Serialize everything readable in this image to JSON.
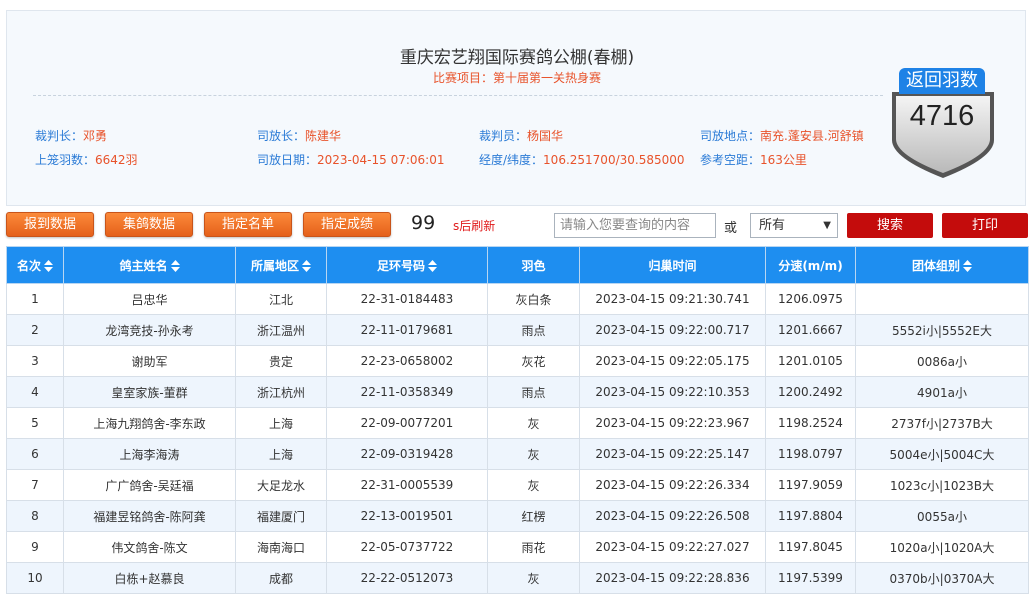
{
  "header": {
    "title": "重庆宏艺翔国际赛鸽公棚(春棚)",
    "subtitle": "比赛项目：第十届第一关热身赛",
    "info": [
      {
        "key": "裁判长：",
        "value": "邓勇"
      },
      {
        "key": "司放长：",
        "value": "陈建华"
      },
      {
        "key": "裁判员：",
        "value": "杨国华"
      },
      {
        "key": "司放地点：",
        "value": "南充.蓬安县.河舒镇"
      },
      {
        "key": "上笼羽数：",
        "value": "6642羽"
      },
      {
        "key": "司放日期：",
        "value": "2023-04-15 07:06:01"
      },
      {
        "key": "经度/纬度：",
        "value": "106.251700/30.585000"
      },
      {
        "key": "参考空距：",
        "value": "163公里"
      }
    ]
  },
  "returns": {
    "label": "返回羽数",
    "count": "4716",
    "color": "#1e82e6"
  },
  "toolbar": {
    "buttons": [
      "报到数据",
      "集鸽数据",
      "指定名单",
      "指定成绩"
    ],
    "countdown": "99",
    "countdown_suffix": "s后刷新",
    "search_placeholder": "请输入您要查询的内容",
    "or_label": "或",
    "select_value": "所有",
    "search_label": "搜索",
    "print_label": "打印"
  },
  "table": {
    "columns": [
      "名次",
      "鸽主姓名",
      "所属地区",
      "足环号码",
      "羽色",
      "归巢时间",
      "分速(m/m)",
      "团体组别"
    ],
    "sortable": [
      true,
      true,
      true,
      true,
      false,
      false,
      false,
      true
    ],
    "rows": [
      [
        "1",
        "吕忠华",
        "江北",
        "22-31-0184483",
        "灰白条",
        "2023-04-15 09:21:30.741",
        "1206.0975",
        ""
      ],
      [
        "2",
        "龙湾竞技-孙永考",
        "浙江温州",
        "22-11-0179681",
        "雨点",
        "2023-04-15 09:22:00.717",
        "1201.6667",
        "5552i小|5552E大"
      ],
      [
        "3",
        "谢助军",
        "贵定",
        "22-23-0658002",
        "灰花",
        "2023-04-15 09:22:05.175",
        "1201.0105",
        "0086a小"
      ],
      [
        "4",
        "皇室家族-董群",
        "浙江杭州",
        "22-11-0358349",
        "雨点",
        "2023-04-15 09:22:10.353",
        "1200.2492",
        "4901a小"
      ],
      [
        "5",
        "上海九翔鸽舍-李东政",
        "上海",
        "22-09-0077201",
        "灰",
        "2023-04-15 09:22:23.967",
        "1198.2524",
        "2737f小|2737B大"
      ],
      [
        "6",
        "上海李海涛",
        "上海",
        "22-09-0319428",
        "灰",
        "2023-04-15 09:22:25.147",
        "1198.0797",
        "5004e小|5004C大"
      ],
      [
        "7",
        "广广鸽舍-吴廷福",
        "大足龙水",
        "22-31-0005539",
        "灰",
        "2023-04-15 09:22:26.334",
        "1197.9059",
        "1023c小|1023B大"
      ],
      [
        "8",
        "福建昱铭鸽舍-陈阿龚",
        "福建厦门",
        "22-13-0019501",
        "红楞",
        "2023-04-15 09:22:26.508",
        "1197.8804",
        "0055a小"
      ],
      [
        "9",
        "伟文鸽舍-陈文",
        "海南海口",
        "22-05-0737722",
        "雨花",
        "2023-04-15 09:22:27.027",
        "1197.8045",
        "1020a小|1020A大"
      ],
      [
        "10",
        "白栋+赵慕良",
        "成都",
        "22-22-0512073",
        "灰",
        "2023-04-15 09:22:28.836",
        "1197.5399",
        "0370b小|0370A大"
      ]
    ]
  }
}
